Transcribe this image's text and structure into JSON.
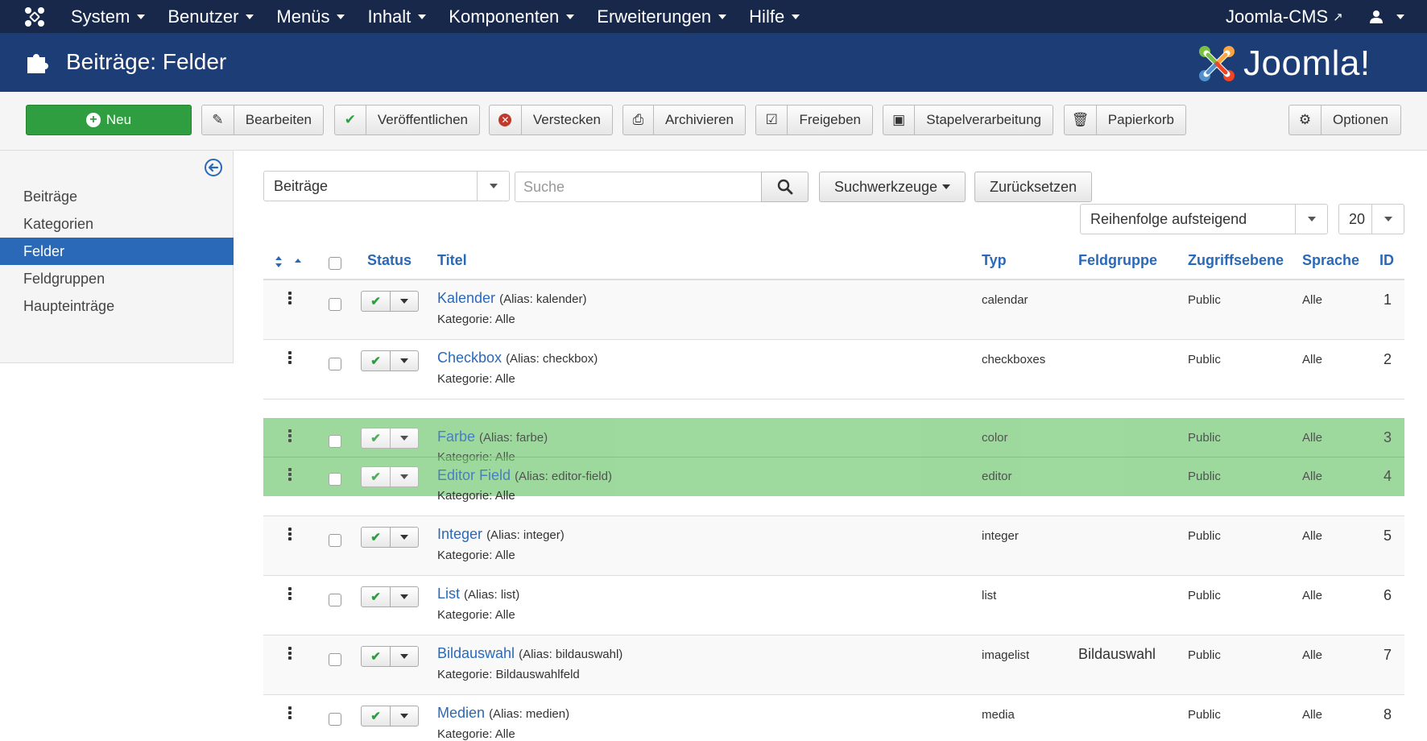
{
  "navbar": {
    "menu": [
      "System",
      "Benutzer",
      "Menüs",
      "Inhalt",
      "Komponenten",
      "Erweiterungen",
      "Hilfe"
    ],
    "site_name": "Joomla-CMS"
  },
  "header": {
    "title": "Beiträge: Felder",
    "logo_text": "Joomla!"
  },
  "toolbar": {
    "new": "Neu",
    "edit": "Bearbeiten",
    "publish": "Veröffentlichen",
    "unpublish": "Verstecken",
    "archive": "Archivieren",
    "checkin": "Freigeben",
    "batch": "Stapelverarbeitung",
    "trash": "Papierkorb",
    "options": "Optionen"
  },
  "sidebar": {
    "items": [
      "Beiträge",
      "Kategorien",
      "Felder",
      "Feldgruppen",
      "Haupteinträge"
    ],
    "active_index": 2
  },
  "filters": {
    "context": "Beiträge",
    "search_placeholder": "Suche",
    "search_tools": "Suchwerkzeuge",
    "reset": "Zurücksetzen",
    "ordering": "Reihenfolge aufsteigend",
    "limit": "20"
  },
  "table": {
    "headers": {
      "status": "Status",
      "title": "Titel",
      "type": "Typ",
      "group": "Feldgruppe",
      "access": "Zugriffsebene",
      "language": "Sprache",
      "id": "ID"
    },
    "rows": [
      {
        "title": "Kalender",
        "alias": "(Alias: kalender)",
        "category": "Kategorie: Alle",
        "type": "calendar",
        "group": "",
        "access": "Public",
        "language": "Alle",
        "id": "1"
      },
      {
        "title": "Checkbox",
        "alias": "(Alias: checkbox)",
        "category": "Kategorie: Alle",
        "type": "checkboxes",
        "group": "",
        "access": "Public",
        "language": "Alle",
        "id": "2"
      },
      {
        "title": "Farbe",
        "alias": "(Alias: farbe)",
        "category": "Kategorie: Alle",
        "type": "color",
        "group": "",
        "access": "Public",
        "language": "Alle",
        "id": "3"
      },
      {
        "title": "Editor Field",
        "alias": "(Alias: editor-field)",
        "category": "Kategorie: Alle",
        "type": "editor",
        "group": "",
        "access": "Public",
        "language": "Alle",
        "id": "4"
      },
      {
        "title": "Integer",
        "alias": "(Alias: integer)",
        "category": "Kategorie: Alle",
        "type": "integer",
        "group": "",
        "access": "Public",
        "language": "Alle",
        "id": "5"
      },
      {
        "title": "List",
        "alias": "(Alias: list)",
        "category": "Kategorie: Alle",
        "type": "list",
        "group": "",
        "access": "Public",
        "language": "Alle",
        "id": "6"
      },
      {
        "title": "Bildauswahl",
        "alias": "(Alias: bildauswahl)",
        "category": "Kategorie: Bildauswahlfeld",
        "type": "imagelist",
        "group": "Bildauswahl",
        "access": "Public",
        "language": "Alle",
        "id": "7"
      },
      {
        "title": "Medien",
        "alias": "(Alias: medien)",
        "category": "Kategorie: Alle",
        "type": "media",
        "group": "",
        "access": "Public",
        "language": "Alle",
        "id": "8"
      }
    ]
  },
  "colors": {
    "navbar": "#17284a",
    "header": "#1c3d75",
    "accent": "#2a69b8",
    "success": "#2f9e41",
    "drag_highlight": "#60c260"
  }
}
